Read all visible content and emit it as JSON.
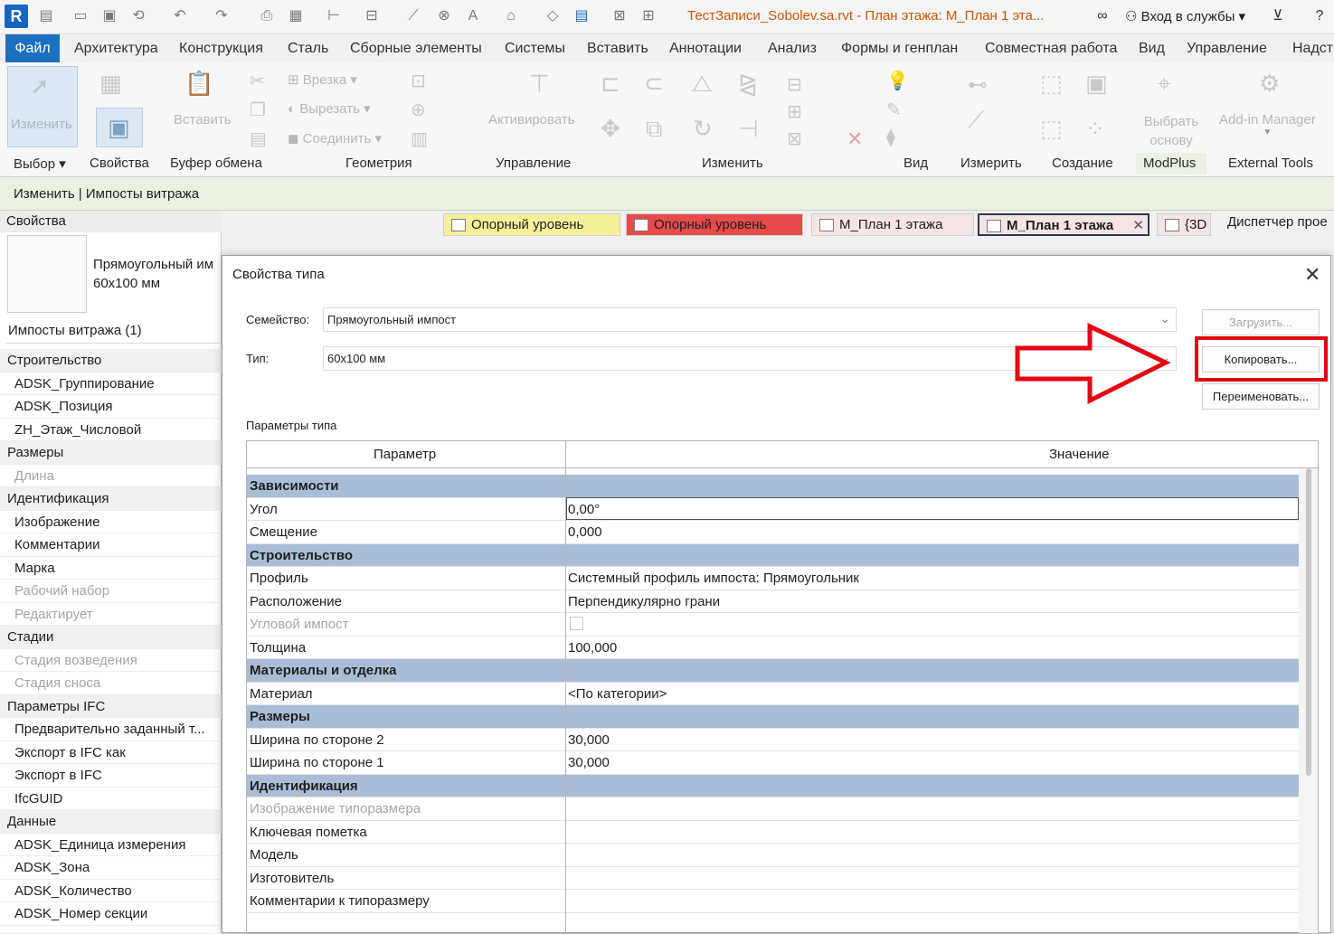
{
  "titlebar": {
    "logo": "R",
    "document_title": "ТестЗаписи_Sobolev.sa.rvt - План этажа: М_План 1 эта...",
    "sign_in": "Вход в службы"
  },
  "ribbon_tabs": [
    {
      "label": "Файл"
    },
    {
      "label": "Архитектура"
    },
    {
      "label": "Конструкция"
    },
    {
      "label": "Сталь"
    },
    {
      "label": "Сборные элементы"
    },
    {
      "label": "Системы"
    },
    {
      "label": "Вставить"
    },
    {
      "label": "Аннотации"
    },
    {
      "label": "Анализ"
    },
    {
      "label": "Формы и генплан"
    },
    {
      "label": "Совместная работа"
    },
    {
      "label": "Вид"
    },
    {
      "label": "Управление"
    },
    {
      "label": "Надстр"
    }
  ],
  "ribbon": {
    "modify": "Изменить",
    "paste": "Вставить",
    "cope": "Врезка",
    "cut": "Вырезать",
    "join": "Соединить",
    "activate": "Активировать",
    "pick_base": "Выбрать основу",
    "addin_manager": "Add-in Manager",
    "panels": [
      "Выбор",
      "Свойства",
      "Буфер обмена",
      "Геометрия",
      "Управление",
      "Изменить",
      "Вид",
      "Измерить",
      "Создание",
      "ModPlus",
      "External Tools"
    ]
  },
  "context_bar": "Изменить | Импосты витража",
  "properties": {
    "title": "Свойства",
    "type_line1": "Прямоугольный им",
    "type_line2": "60x100 мм",
    "instance_count": "Импосты витража (1)",
    "rows": [
      {
        "label": "Строительство",
        "kind": "grp"
      },
      {
        "label": "ADSK_Группирование",
        "kind": "row"
      },
      {
        "label": "ADSK_Позиция",
        "kind": "row"
      },
      {
        "label": "ZH_Этаж_Числовой",
        "kind": "row"
      },
      {
        "label": "Размеры",
        "kind": "grp"
      },
      {
        "label": "Длина",
        "kind": "dim"
      },
      {
        "label": "Идентификация",
        "kind": "grp"
      },
      {
        "label": "Изображение",
        "kind": "row"
      },
      {
        "label": "Комментарии",
        "kind": "row"
      },
      {
        "label": "Марка",
        "kind": "row"
      },
      {
        "label": "Рабочий набор",
        "kind": "dim"
      },
      {
        "label": "Редактирует",
        "kind": "dim"
      },
      {
        "label": "Стадии",
        "kind": "grp"
      },
      {
        "label": "Стадия возведения",
        "kind": "dim"
      },
      {
        "label": "Стадия сноса",
        "kind": "dim"
      },
      {
        "label": "Параметры IFC",
        "kind": "grp"
      },
      {
        "label": "Предварительно заданный т...",
        "kind": "row"
      },
      {
        "label": "Экспорт в IFC как",
        "kind": "row"
      },
      {
        "label": "Экспорт в IFC",
        "kind": "row"
      },
      {
        "label": "IfcGUID",
        "kind": "row"
      },
      {
        "label": "Данные",
        "kind": "grp"
      },
      {
        "label": "ADSK_Единица измерения",
        "kind": "row"
      },
      {
        "label": "ADSK_Зона",
        "kind": "row"
      },
      {
        "label": "ADSK_Количество",
        "kind": "row"
      },
      {
        "label": "ADSK_Номер секции",
        "kind": "row"
      }
    ]
  },
  "view_tabs": [
    {
      "label": "Опорный уровень",
      "color": "#f4f19a"
    },
    {
      "label": "Опорный уровень",
      "color": "#e64a4a"
    },
    {
      "label": "М_План 1 этажа",
      "color": "#f5e4e4"
    },
    {
      "label": "М_План 1 этажа",
      "color": "#f5e4e4"
    },
    {
      "label": "{3D -",
      "color": "#f5e4e4"
    }
  ],
  "project_browser": "Диспетчер прое",
  "dialog": {
    "title": "Свойства типа",
    "family_label": "Семейство:",
    "family_value": "Прямоугольный импост",
    "type_label": "Тип:",
    "type_value": "60x100 мм",
    "load_button": "Загрузить...",
    "duplicate_button": "Копировать...",
    "rename_button": "Переименовать...",
    "type_params_label": "Параметры типа",
    "col_param": "Параметр",
    "col_value": "Значение",
    "highlight_color": "#e30613",
    "rows": [
      {
        "param": "Зависимости",
        "value": "",
        "kind": "grp"
      },
      {
        "param": "Угол",
        "value": "0,00°",
        "kind": "row"
      },
      {
        "param": "Смещение",
        "value": "0,000",
        "kind": "row"
      },
      {
        "param": "Строительство",
        "value": "",
        "kind": "grp"
      },
      {
        "param": "Профиль",
        "value": "Системный профиль импоста: Прямоугольник",
        "kind": "row"
      },
      {
        "param": "Расположение",
        "value": "Перпендикулярно грани",
        "kind": "row"
      },
      {
        "param": "Угловой импост",
        "value": "",
        "kind": "dim"
      },
      {
        "param": "Толщина",
        "value": "100,000",
        "kind": "row"
      },
      {
        "param": "Материалы и отделка",
        "value": "",
        "kind": "grp"
      },
      {
        "param": "Материал",
        "value": "<По категории>",
        "kind": "row"
      },
      {
        "param": "Размеры",
        "value": "",
        "kind": "grp"
      },
      {
        "param": "Ширина по стороне 2",
        "value": "30,000",
        "kind": "row"
      },
      {
        "param": "Ширина по стороне 1",
        "value": "30,000",
        "kind": "row"
      },
      {
        "param": "Идентификация",
        "value": "",
        "kind": "grp"
      },
      {
        "param": "Изображение типоразмера",
        "value": "",
        "kind": "dim"
      },
      {
        "param": "Ключевая пометка",
        "value": "",
        "kind": "row"
      },
      {
        "param": "Модель",
        "value": "",
        "kind": "row"
      },
      {
        "param": "Изготовитель",
        "value": "",
        "kind": "row"
      },
      {
        "param": "Комментарии к типоразмеру",
        "value": "",
        "kind": "row"
      }
    ]
  }
}
